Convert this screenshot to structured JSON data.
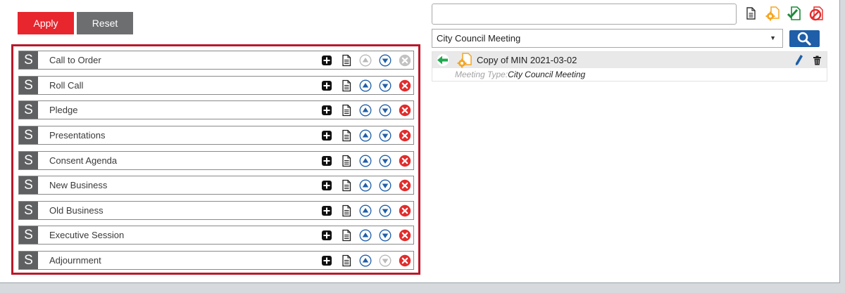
{
  "toolbar": {
    "apply_label": "Apply",
    "reset_label": "Reset"
  },
  "agenda": {
    "badge": "S",
    "items": [
      {
        "label": "Call to Order",
        "up_enabled": false,
        "down_enabled": true,
        "delete_enabled": false
      },
      {
        "label": "Roll Call",
        "up_enabled": true,
        "down_enabled": true,
        "delete_enabled": true
      },
      {
        "label": "Pledge",
        "up_enabled": true,
        "down_enabled": true,
        "delete_enabled": true
      },
      {
        "label": "Presentations",
        "up_enabled": true,
        "down_enabled": true,
        "delete_enabled": true
      },
      {
        "label": "Consent Agenda",
        "up_enabled": true,
        "down_enabled": true,
        "delete_enabled": true
      },
      {
        "label": "New Business",
        "up_enabled": true,
        "down_enabled": true,
        "delete_enabled": true
      },
      {
        "label": "Old Business",
        "up_enabled": true,
        "down_enabled": true,
        "delete_enabled": true
      },
      {
        "label": "Executive Session",
        "up_enabled": true,
        "down_enabled": true,
        "delete_enabled": true
      },
      {
        "label": "Adjournment",
        "up_enabled": true,
        "down_enabled": false,
        "delete_enabled": true
      }
    ]
  },
  "search": {
    "value": "",
    "placeholder": ""
  },
  "filter": {
    "selected": "City Council Meeting"
  },
  "results": [
    {
      "title": "Copy of MIN 2021-03-02",
      "meta_key": "Meeting Type:",
      "meta_value": "City Council Meeting"
    }
  ],
  "colors": {
    "accent": "#e8262e",
    "frame": "#b9182a",
    "arrow_blue": "#1f5ea8",
    "green": "#21a84f",
    "orange": "#f5a623"
  },
  "icons": {
    "row": [
      "plus-icon",
      "document-icon",
      "arrow-up-icon",
      "arrow-down-icon",
      "delete-icon"
    ],
    "toolbar": [
      "document-icon",
      "gear-document-icon",
      "check-document-icon",
      "cancel-icon"
    ]
  }
}
